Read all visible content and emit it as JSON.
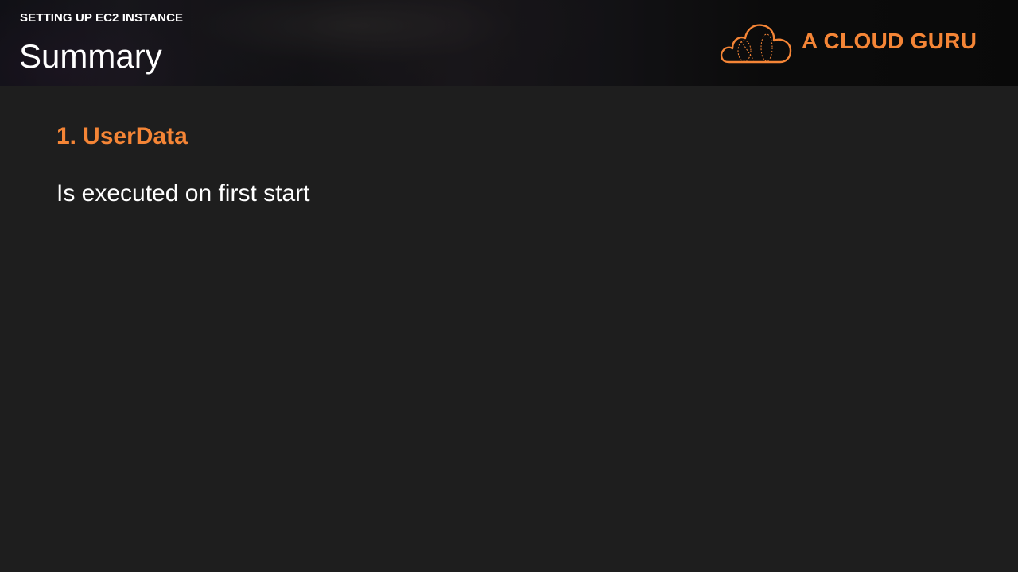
{
  "header": {
    "course_title": "SETTING UP EC2 INSTANCE",
    "section_title": "Summary"
  },
  "logo": {
    "text": "A CLOUD GURU",
    "icon": "cloud-icon",
    "color": "#f58536"
  },
  "content": {
    "points": [
      {
        "number": "1.",
        "heading": "UserData",
        "body": "Is executed on first start"
      }
    ]
  },
  "colors": {
    "accent": "#f58536",
    "background": "#1e1e1e",
    "text": "#ffffff"
  }
}
